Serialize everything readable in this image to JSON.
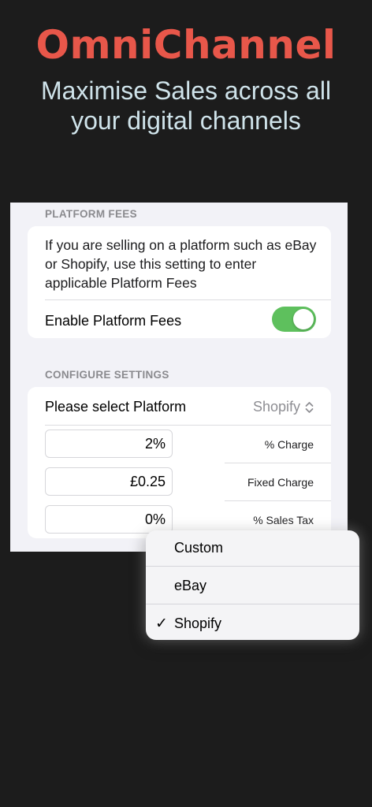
{
  "hero": {
    "title": "OmniChannel",
    "subtitle_line1": "Maximise Sales across all",
    "subtitle_line2": "your digital channels"
  },
  "platform_fees": {
    "header": "PLATFORM FEES",
    "description": "If you are selling on a platform such as eBay or Shopify, use this setting to enter applicable Platform Fees",
    "enable_label": "Enable Platform Fees",
    "enabled": true
  },
  "configure": {
    "header": "CONFIGURE SETTINGS",
    "select_label": "Please select Platform",
    "selected_platform": "Shopify",
    "fields": [
      {
        "value": "2%",
        "label": "% Charge"
      },
      {
        "value": "£0.25",
        "label": "Fixed Charge"
      },
      {
        "value": "0%",
        "label": "% Sales Tax"
      }
    ]
  },
  "dropdown": {
    "options": [
      {
        "label": "Custom",
        "checked": false
      },
      {
        "label": "eBay",
        "checked": false
      },
      {
        "label": "Shopify",
        "checked": true
      }
    ],
    "check_glyph": "✓"
  },
  "colors": {
    "brand": "#e8574a",
    "toggle_on": "#5ec05d",
    "background": "#1c1c1c"
  }
}
